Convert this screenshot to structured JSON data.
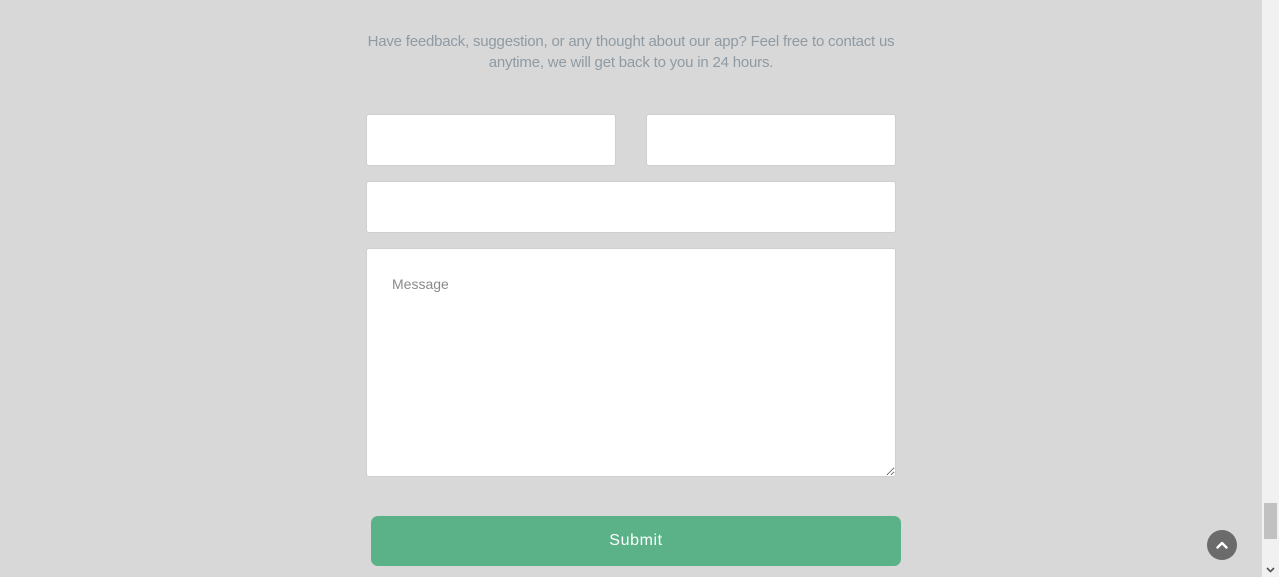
{
  "contact": {
    "intro_line1": "Have feedback, suggestion, or any thought about our app? Feel free to contact us",
    "intro_line2": "anytime, we will get back to you in 24 hours.",
    "first_name_value": "",
    "last_name_value": "",
    "email_value": "",
    "message_placeholder": "Message",
    "submit_label": "Submit"
  },
  "icons": {
    "back_to_top": "chevron-up-icon",
    "scroll_down": "chevron-down-icon"
  },
  "colors": {
    "background": "#d8d8d8",
    "intro_text": "#8f9aa3",
    "submit_button": "#5bb288",
    "back_to_top": "#6b6b6b"
  }
}
